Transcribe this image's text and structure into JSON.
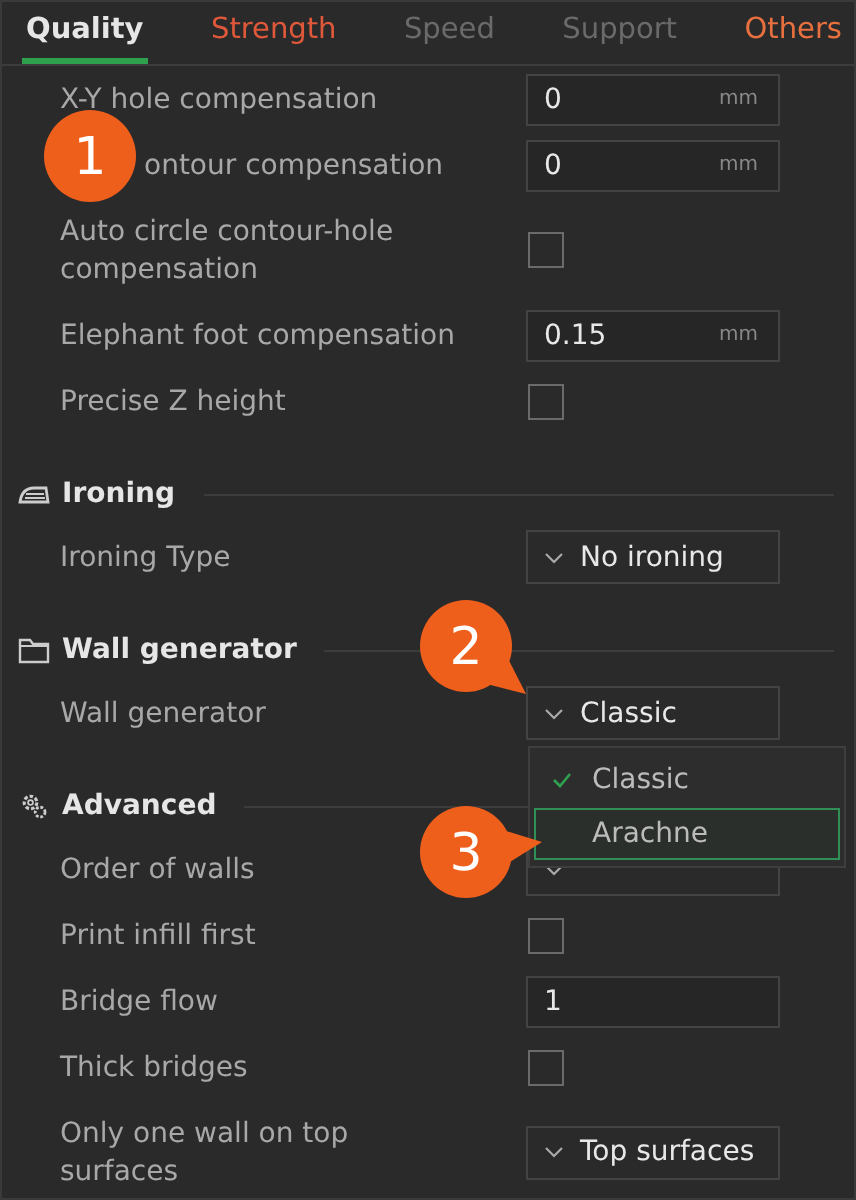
{
  "tabs": [
    {
      "label": "Quality",
      "selected": true,
      "color": "#e6e6e6"
    },
    {
      "label": "Strength",
      "selected": false,
      "color": "#e0583a"
    },
    {
      "label": "Speed",
      "selected": false,
      "color": "#6a6a6a"
    },
    {
      "label": "Support",
      "selected": false,
      "color": "#6a6a6a"
    },
    {
      "label": "Others",
      "selected": false,
      "color": "#e8703e"
    }
  ],
  "groups": [
    {
      "rows": [
        {
          "kind": "field",
          "label": "X-Y hole compensation",
          "value": "0",
          "unit": "mm"
        },
        {
          "kind": "field",
          "label": "ontour compensation",
          "value": "0",
          "unit": "mm"
        },
        {
          "kind": "check",
          "label": "Auto circle contour-hole compensation",
          "checked": false
        },
        {
          "kind": "field",
          "label": "Elephant foot compensation",
          "value": "0.15",
          "unit": "mm"
        },
        {
          "kind": "check",
          "label": "Precise Z height",
          "checked": false
        }
      ]
    },
    {
      "title": "Ironing",
      "rows": [
        {
          "kind": "select",
          "label": "Ironing Type",
          "value": "No ironing"
        }
      ]
    },
    {
      "title": "Wall generator",
      "rows": [
        {
          "kind": "select",
          "label": "Wall generator",
          "value": "Classic",
          "open": true,
          "options": [
            {
              "label": "Classic",
              "selected": true,
              "hover": false
            },
            {
              "label": "Arachne",
              "selected": false,
              "hover": true
            }
          ]
        }
      ]
    },
    {
      "title": "Advanced",
      "rows": [
        {
          "kind": "select",
          "label": "Order of walls"
        },
        {
          "kind": "check",
          "label": "Print infill first",
          "checked": false
        },
        {
          "kind": "field",
          "label": "Bridge flow",
          "value": "1"
        },
        {
          "kind": "check",
          "label": "Thick bridges",
          "checked": false
        },
        {
          "kind": "select",
          "label": "Only one wall on top surfaces",
          "value": "Top surfaces"
        }
      ]
    }
  ],
  "callouts": [
    {
      "label": "1"
    },
    {
      "label": "2"
    },
    {
      "label": "3"
    }
  ]
}
